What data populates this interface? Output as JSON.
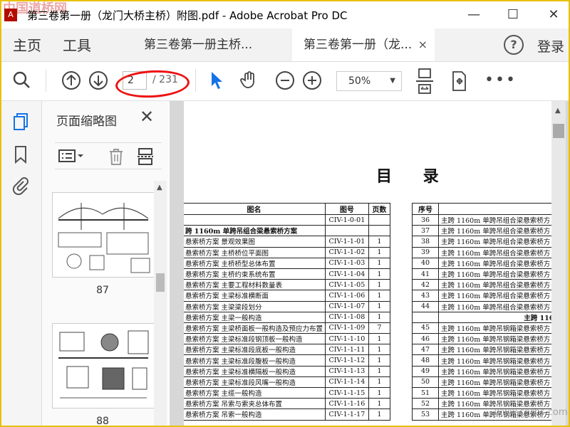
{
  "window": {
    "title": "第三卷第一册（龙门大桥主桥）附图.pdf - Adobe Acrobat Pro DC",
    "minimize": "—",
    "maximize": "☐",
    "close": "✕",
    "watermark": "中国道桥网"
  },
  "menu": {
    "home": "主页",
    "tools": "工具"
  },
  "tabs": [
    {
      "label": "第三卷第一册主桥...",
      "active": false
    },
    {
      "label": "第三卷第一册（龙...",
      "active": true,
      "close": "×"
    }
  ],
  "account": {
    "help": "?",
    "login": "登录"
  },
  "toolbar": {
    "search_icon": "search-icon",
    "page_current": "2",
    "page_total": "/ 231",
    "zoom": "50%",
    "annotation_color": "#e11111"
  },
  "thumbnails": {
    "title": "页面缩略图",
    "pages": [
      {
        "number": "87"
      },
      {
        "number": "88"
      }
    ]
  },
  "document": {
    "heading": "目  录",
    "left_table": {
      "headers": [
        "图名",
        "图号",
        "页数"
      ],
      "rows": [
        [
          "",
          "CIV-1-0-01",
          ""
        ],
        [
          "跨 1160m 单跨吊组合梁悬索桥方案",
          "",
          ""
        ],
        [
          "悬索桥方案 景观效果图",
          "CIV-1-1-01",
          "1"
        ],
        [
          "悬索桥方案 主桥桥位平面图",
          "CIV-1-1-02",
          "1"
        ],
        [
          "悬索桥方案 主桥桥型总体布置",
          "CIV-1-1-03",
          "1"
        ],
        [
          "悬索桥方案 主桥约束系统布置",
          "CIV-1-1-04",
          "1"
        ],
        [
          "悬索桥方案 主要工程材料数量表",
          "CIV-1-1-05",
          "1"
        ],
        [
          "悬索桥方案 主梁标准横断面",
          "CIV-1-1-06",
          "1"
        ],
        [
          "悬索桥方案 主梁梁段划分",
          "CIV-1-1-07",
          "1"
        ],
        [
          "悬索桥方案 主梁一般构造",
          "CIV-1-1-08",
          "1"
        ],
        [
          "悬索桥方案 主梁桥面板一般构造及预应力布置",
          "CIV-1-1-09",
          "7"
        ],
        [
          "悬索桥方案 主梁标准段钢顶板一般构造",
          "CIV-1-1-10",
          "1"
        ],
        [
          "悬索桥方案 主梁标准段底板一般构造",
          "CIV-1-1-11",
          "1"
        ],
        [
          "悬索桥方案 主梁标准段腹板一般构造",
          "CIV-1-1-12",
          "1"
        ],
        [
          "悬索桥方案 主梁标准横隔板一般构造",
          "CIV-1-1-13",
          "1"
        ],
        [
          "悬索桥方案 主梁标准段风嘴一般构造",
          "CIV-1-1-14",
          "1"
        ],
        [
          "悬索桥方案 主缆一般构造",
          "CIV-1-1-15",
          "1"
        ],
        [
          "悬索桥方案 吊索与索夹总体布置",
          "CIV-1-1-16",
          "1"
        ],
        [
          "悬索桥方案 吊索一般构造",
          "CIV-1-1-17",
          "1"
        ]
      ]
    },
    "right_table": {
      "headers": [
        "序号",
        "图"
      ],
      "rows": [
        [
          "36",
          "主跨 1160m 单跨吊组合梁悬索桥方"
        ],
        [
          "37",
          "主跨 1160m 单跨吊组合梁悬索桥方"
        ],
        [
          "38",
          "主跨 1160m 单跨吊组合梁悬索桥方"
        ],
        [
          "39",
          "主跨 1160m 单跨吊组合梁悬索桥方"
        ],
        [
          "40",
          "主跨 1160m 单跨吊组合梁悬索桥方"
        ],
        [
          "41",
          "主跨 1160m 单跨吊组合梁悬索桥方"
        ],
        [
          "42",
          "主跨 1160m 单跨吊组合梁悬索桥方"
        ],
        [
          "43",
          "主跨 1160m 单跨吊组合梁悬索桥方"
        ],
        [
          "44",
          "主跨 1160m 单跨吊组合梁悬索桥方"
        ],
        [
          "",
          "主跨 1160m"
        ],
        [
          "45",
          "主跨 1160m 单跨吊钢箱梁悬索桥方"
        ],
        [
          "46",
          "主跨 1160m 单跨吊钢箱梁悬索桥方"
        ],
        [
          "47",
          "主跨 1160m 单跨吊钢箱梁悬索桥方"
        ],
        [
          "48",
          "主跨 1160m 单跨吊钢箱梁悬索桥方"
        ],
        [
          "49",
          "主跨 1160m 单跨吊钢箱梁悬索桥方"
        ],
        [
          "50",
          "主跨 1160m 单跨吊钢箱梁悬索桥方"
        ],
        [
          "51",
          "主跨 1160m 单跨吊钢箱梁悬索桥方"
        ],
        [
          "52",
          "主跨 1160m 单跨吊钢箱梁悬索桥方"
        ],
        [
          "53",
          "主跨 1160m 单跨吊钢箱梁悬索桥方"
        ]
      ]
    }
  },
  "footer_watermark": "www.cnrbs.com"
}
